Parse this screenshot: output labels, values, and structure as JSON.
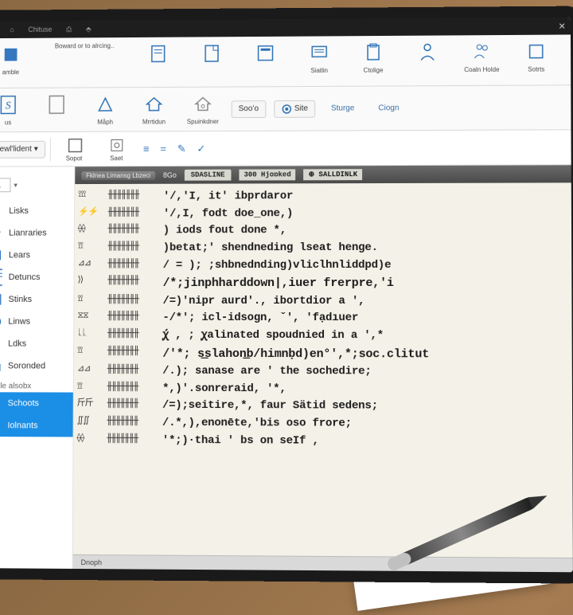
{
  "titlebar": {
    "t1": "⟳",
    "t2": "⌂",
    "t3": "Chituse",
    "t4": "⎙",
    "t5": "⬘",
    "close": "✕"
  },
  "ribbonTop": [
    {
      "label": "amble",
      "icon": "app"
    },
    {
      "label": "Boward or to alrcing..",
      "icon": "none",
      "wide": true
    },
    {
      "label": "",
      "icon": "doc"
    },
    {
      "label": "",
      "icon": "file"
    },
    {
      "label": "",
      "icon": "page"
    },
    {
      "label": "Siatlin",
      "icon": "msg"
    },
    {
      "label": "Ctolige",
      "icon": "clip"
    },
    {
      "label": "",
      "icon": "user"
    },
    {
      "label": "Coaln Holde",
      "icon": "user2"
    },
    {
      "label": "Sotrts",
      "icon": "box"
    }
  ],
  "ribbonTop2": [
    {
      "label": "us",
      "icon": "dollar"
    },
    {
      "label": "",
      "icon": "blank"
    },
    {
      "label": "Måph",
      "icon": "tri"
    },
    {
      "label": "Mrrtidun",
      "icon": "house"
    },
    {
      "label": "Spuinkdner",
      "icon": "house2"
    },
    {
      "label": "Sooʻo",
      "btn": true
    },
    {
      "label": "Site",
      "btn": true,
      "icon": "dot"
    },
    {
      "label": "Sturge",
      "text": true
    },
    {
      "label": "Ciogn",
      "text": true
    }
  ],
  "ribbonMid": {
    "tab": "Sewl'lident",
    "items": [
      {
        "label": "Sopot",
        "icon": "box"
      },
      {
        "label": "Saet",
        "icon": "prop"
      }
    ],
    "glyphs": [
      "≡",
      "=",
      "✎",
      "✓"
    ]
  },
  "sidebar": {
    "page": "1",
    "items": [
      {
        "label": "Lisks",
        "icon": "link"
      },
      {
        "label": "Lianraries",
        "icon": "star"
      },
      {
        "label": "Lears",
        "icon": "pencil"
      },
      {
        "label": "Detuncs",
        "icon": "doc"
      },
      {
        "label": "Stinks",
        "icon": "list"
      },
      {
        "label": "Linws",
        "icon": "globe"
      },
      {
        "label": "Ldks",
        "icon": "swap"
      },
      {
        "label": "Soronded",
        "icon": "layer"
      }
    ],
    "group": "Sidle alsobx",
    "footer": [
      {
        "label": "Schoots",
        "icon": "lock",
        "active": true
      },
      {
        "label": "Iolnants",
        "icon": "play",
        "active": true
      }
    ]
  },
  "editorHeader": {
    "pill": "Fklnea Limansg Lbzeci",
    "num": "8Go",
    "tab": "SDASLINE",
    "t2": "300 Hjoɒked",
    "t3": "⊕ SALLDINLK"
  },
  "editorLines": [
    {
      "lg": "⟟⟟⟟",
      "gut": "╫╫╫╫╫╫╫",
      "code": "'/,'I, it' ibprdaror"
    },
    {
      "lg": "⚡⚡",
      "gut": "╫╫╫╫╫╫╫",
      "code": "'/,I, fodt doe_one,)"
    },
    {
      "lg": "⟠⟠",
      "gut": "╫╫╫╫╫╫╫",
      "code": ") iods fout done *,"
    },
    {
      "lg": "⟟⟟",
      "gut": "╫╫╫╫╫╫╫",
      "code": ")betat;'   shendneding lseat henge."
    },
    {
      "lg": "⊿⊿",
      "gut": "╫╫╫╫╫╫╫",
      "code": "/ = );          ;shbnednding)vliclhnliddpd)e"
    },
    {
      "lg": "⟩⟩",
      "gut": "╫╫╫╫╫╫╫",
      "code": "/*;jinphharddown|,iuer frerpre,'i",
      "strong": true
    },
    {
      "lg": "⟟⟟",
      "gut": "╫╫╫╫╫╫╫",
      "code": "/=)'nipr aurd'.,   ibortdior a ',"
    },
    {
      "lg": "⧖⧖",
      "gut": "╫╫╫╫╫╫╫",
      "code": "-/*'; icl-idsogn,         ˇ', 'fạdıuer"
    },
    {
      "lg": "ᚳᚳ",
      "gut": "╫╫╫╫╫╫╫",
      "code": "ꭕ́ , ; ꭕalinated spoudnied in a ',*"
    },
    {
      "lg": "⟟⟟",
      "gut": "╫╫╫╫╫╫╫",
      "code": "/'*; s͟slahon͟b/himnḅd)en°',*;soc.clitut",
      "strong": true
    },
    {
      "lg": "⊿⊿",
      "gut": "╫╫╫╫╫╫╫",
      "code": "/.); sanase are ' the sochedire;"
    },
    {
      "lg": "⟟⟟",
      "gut": "╫╫╫╫╫╫╫",
      "code": "*,)'.sonreraid,  '*,"
    },
    {
      "lg": "斤斤",
      "gut": "╫╫╫╫╫╫╫",
      "code": "/=);seitire,*,   faur Sätid sedens;"
    },
    {
      "lg": "∬∬",
      "gut": "╫╫╫╫╫╫╫",
      "code": "/.*,),enonēte,'bis oso frore;"
    },
    {
      "lg": "⟠⟠",
      "gut": "╫╫╫╫╫╫╫",
      "code": "'*;)·thai ' bs on seIf ,"
    }
  ],
  "status": "Dnoph"
}
